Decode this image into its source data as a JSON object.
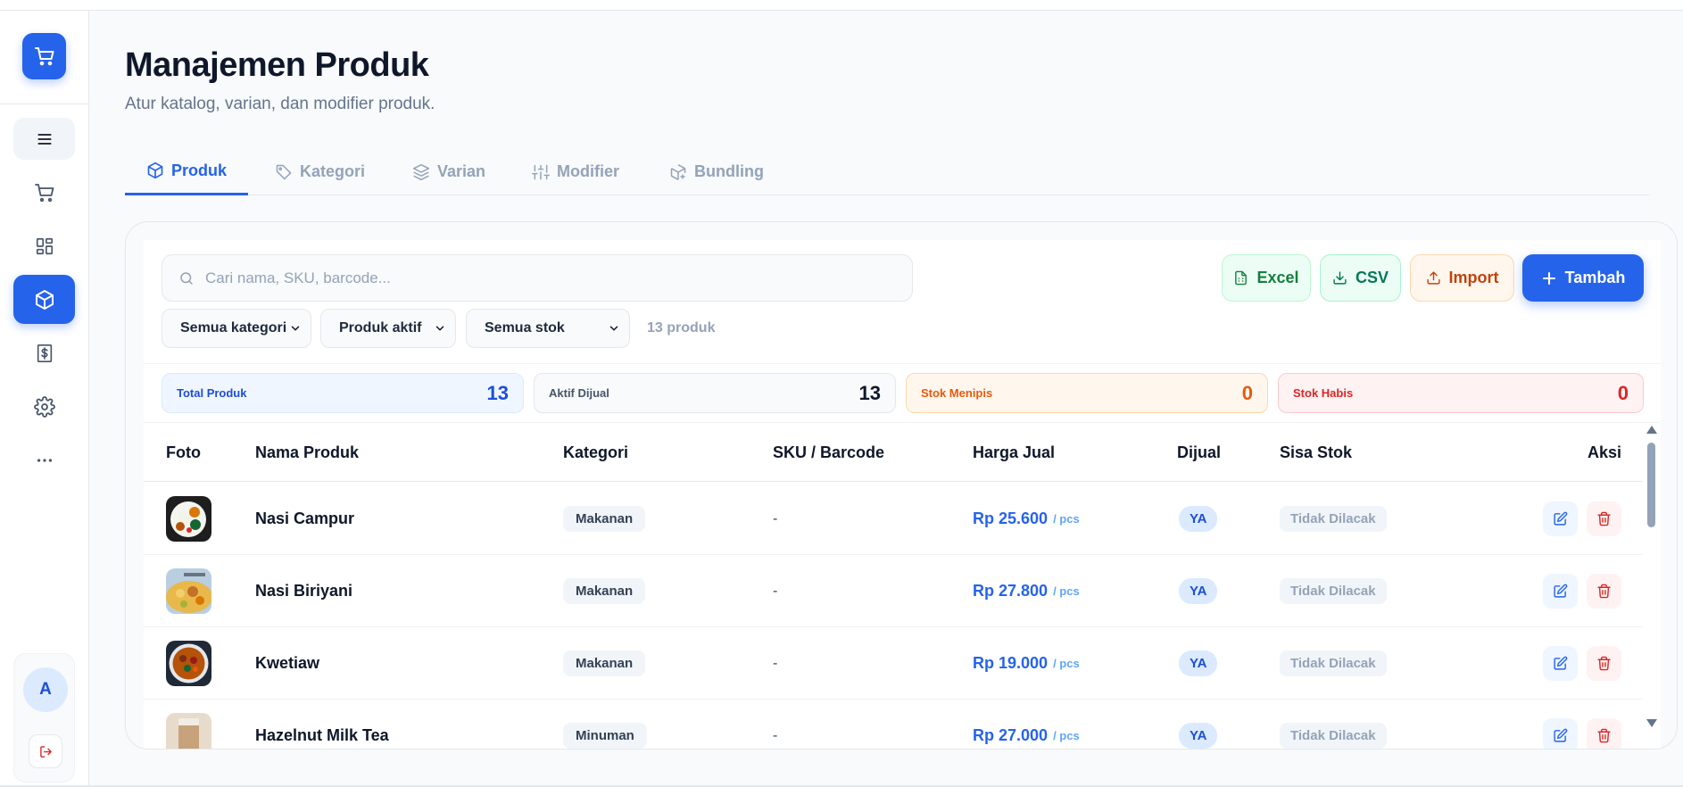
{
  "header": {
    "title": "Manajemen Produk",
    "subtitle": "Atur katalog, varian, dan modifier produk."
  },
  "sidebar": {
    "avatar_initial": "A",
    "items": [
      {
        "icon": "menu-icon"
      },
      {
        "icon": "cart-icon"
      },
      {
        "icon": "dashboard-icon"
      },
      {
        "icon": "box-icon",
        "active": true
      },
      {
        "icon": "money-icon"
      },
      {
        "icon": "gear-icon"
      },
      {
        "icon": "more-icon"
      }
    ]
  },
  "tabs": [
    {
      "label": "Produk",
      "active": true
    },
    {
      "label": "Kategori"
    },
    {
      "label": "Varian"
    },
    {
      "label": "Modifier"
    },
    {
      "label": "Bundling"
    }
  ],
  "toolbar": {
    "search_placeholder": "Cari nama, SKU, barcode...",
    "excel_label": "Excel",
    "csv_label": "CSV",
    "import_label": "Import",
    "add_label": "Tambah"
  },
  "filters": {
    "category": "Semua kategori",
    "status": "Produk aktif",
    "stock": "Semua stok",
    "count": "13 produk"
  },
  "stats": {
    "total": {
      "label": "Total Produk",
      "value": "13"
    },
    "aktif": {
      "label": "Aktif Dijual",
      "value": "13"
    },
    "menipis": {
      "label": "Stok Menipis",
      "value": "0"
    },
    "habis": {
      "label": "Stok Habis",
      "value": "0"
    }
  },
  "table": {
    "headers": {
      "foto": "Foto",
      "nama": "Nama Produk",
      "kategori": "Kategori",
      "sku": "SKU / Barcode",
      "harga": "Harga Jual",
      "dijual": "Dijual",
      "stok": "Sisa Stok",
      "aksi": "Aksi"
    },
    "rows": [
      {
        "name": "Nasi Campur",
        "category": "Makanan",
        "sku": "-",
        "price": "Rp 25.600",
        "unit": "/ pcs",
        "sold": "YA",
        "stock": "Tidak Dilacak"
      },
      {
        "name": "Nasi Biriyani",
        "category": "Makanan",
        "sku": "-",
        "price": "Rp 27.800",
        "unit": "/ pcs",
        "sold": "YA",
        "stock": "Tidak Dilacak"
      },
      {
        "name": "Kwetiaw",
        "category": "Makanan",
        "sku": "-",
        "price": "Rp 19.000",
        "unit": "/ pcs",
        "sold": "YA",
        "stock": "Tidak Dilacak"
      },
      {
        "name": "Hazelnut Milk Tea",
        "category": "Minuman",
        "sku": "-",
        "price": "Rp 27.000",
        "unit": "/ pcs",
        "sold": "YA",
        "stock": "Tidak Dilacak"
      }
    ]
  },
  "colors": {
    "accent": "#2563eb",
    "danger": "#dc2626",
    "warning": "#ea580c",
    "success": "#15803d"
  }
}
